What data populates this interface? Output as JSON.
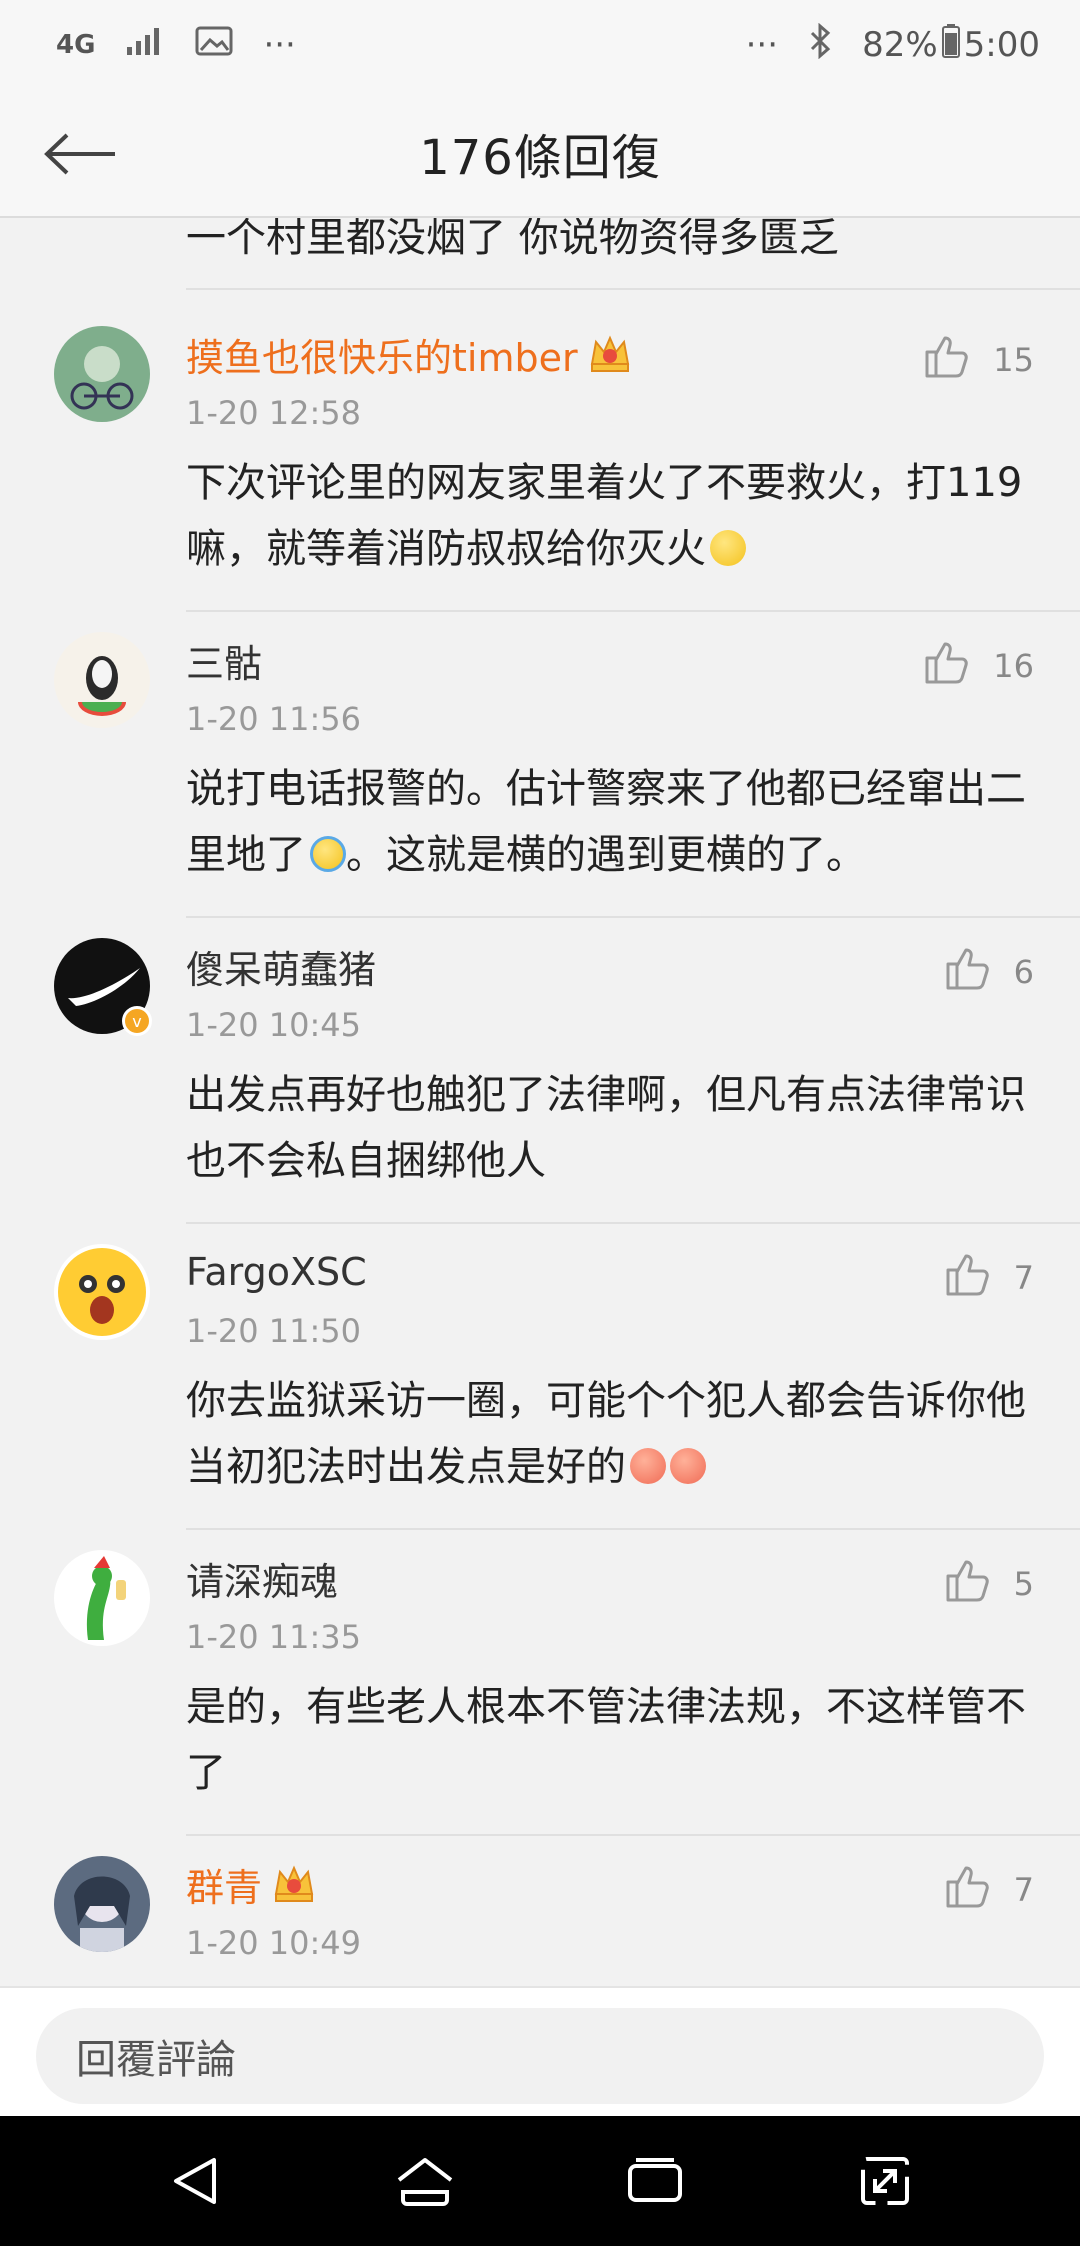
{
  "status_bar": {
    "network": "4G",
    "more_left": "···",
    "more_right": "···",
    "battery": "82%",
    "time": "5:00"
  },
  "header": {
    "title": "176條回復"
  },
  "previous_comment_tail": "一个村里都没烟了 你说物资得多匮乏",
  "comments": [
    {
      "username": "摸鱼也很快乐的timber",
      "vip": true,
      "time": "1-20 12:58",
      "likes": "15",
      "text": "下次评论里的网友家里着火了不要救火，打119嘛，就等着消防叔叔给你灭火",
      "emoji": "smile-emoji"
    },
    {
      "username": "三骷",
      "vip": false,
      "time": "1-20 11:56",
      "likes": "16",
      "text_a": "说打电话报警的。估计警察来了他都已经窜出二里地了",
      "text_b": "。这就是横的遇到更横的了。",
      "emoji": "laugh-cry-emoji"
    },
    {
      "username": "傻呆萌蠢猪",
      "vip": false,
      "verified": true,
      "time": "1-20 10:45",
      "likes": "6",
      "text": "出发点再好也触犯了法律啊，但凡有点法律常识也不会私自捆绑他人"
    },
    {
      "username": "FargoXSC",
      "vip": false,
      "time": "1-20 11:50",
      "likes": "7",
      "text": "你去监狱采访一圈，可能个个犯人都会告诉你他当初犯法时出发点是好的",
      "emoji": "grin-emoji"
    },
    {
      "username": "请深痴魂",
      "vip": false,
      "time": "1-20 11:35",
      "likes": "5",
      "text": "是的，有些老人根本不管法律法规，不这样管不了"
    },
    {
      "username": "群青",
      "vip": true,
      "time": "1-20 10:49",
      "likes": "7",
      "text": ""
    }
  ],
  "reply": {
    "placeholder": "回覆評論"
  },
  "colors": {
    "vip_name": "#ee6f1d",
    "background": "#f2f2f2",
    "time": "#999999",
    "nav_bar": "#000000"
  }
}
